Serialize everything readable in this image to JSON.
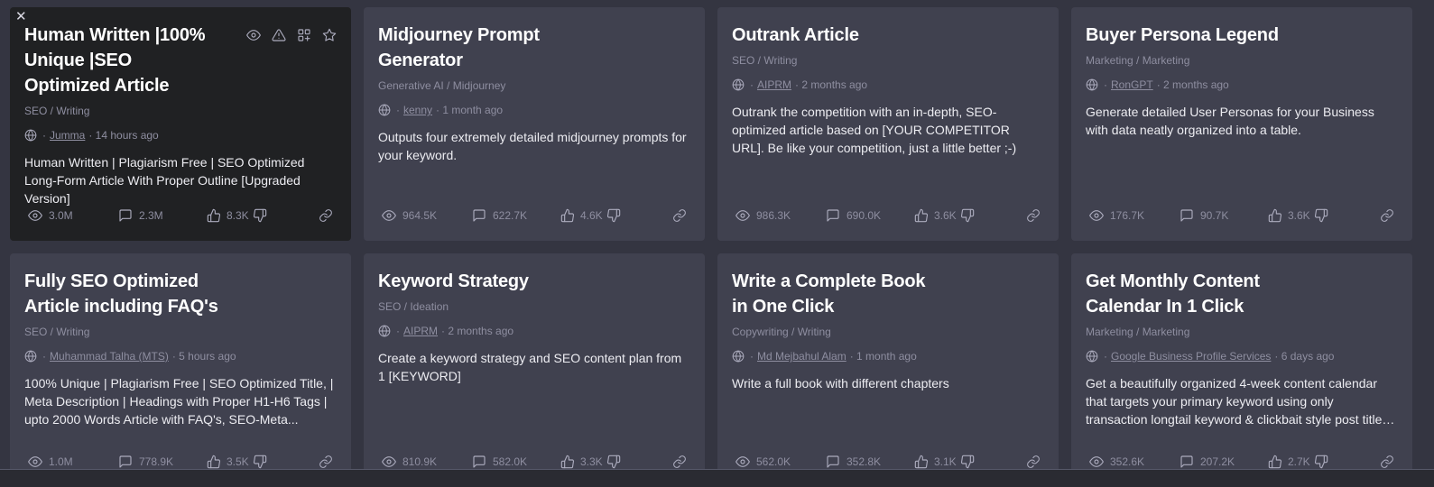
{
  "cards": [
    {
      "title": "Human Written |100% Unique |SEO Optimized Article",
      "category": "SEO / Writing",
      "author": "Jumma",
      "time": "· 14 hours ago",
      "description": "Human Written | Plagiarism Free | SEO Optimized Long-Form Article With Proper Outline [Upgraded Version]",
      "views": "3.0M",
      "comments": "2.3M",
      "likes": "8.3K",
      "active": true
    },
    {
      "title": "Midjourney Prompt Generator",
      "category": "Generative AI / Midjourney",
      "author": "kenny",
      "time": "· 1 month ago",
      "description": "Outputs four extremely detailed midjourney prompts for your keyword.",
      "views": "964.5K",
      "comments": "622.7K",
      "likes": "4.6K"
    },
    {
      "title": "Outrank Article",
      "category": "SEO / Writing",
      "author": "AIPRM",
      "time": "· 2 months ago",
      "description": "Outrank the competition with an in-depth, SEO-optimized article based on [YOUR COMPETITOR URL]. Be like your competition, just a little better ;-)",
      "views": "986.3K",
      "comments": "690.0K",
      "likes": "3.6K"
    },
    {
      "title": "Buyer Persona Legend",
      "category": "Marketing / Marketing",
      "author": "RonGPT",
      "time": "· 2 months ago",
      "description": "Generate detailed User Personas for your Business with data neatly organized into a table.",
      "views": "176.7K",
      "comments": "90.7K",
      "likes": "3.6K"
    },
    {
      "title": "Fully SEO Optimized Article including FAQ's",
      "category": "SEO / Writing",
      "author": "Muhammad Talha (MTS)",
      "time": "· 5 hours ago",
      "description": "100% Unique | Plagiarism Free | SEO Optimized Title, | Meta Description | Headings with Proper H1-H6 Tags | upto 2000 Words Article with FAQ's, SEO-Meta...",
      "views": "1.0M",
      "comments": "778.9K",
      "likes": "3.5K"
    },
    {
      "title": "Keyword Strategy",
      "category": "SEO / Ideation",
      "author": "AIPRM",
      "time": "· 2 months ago",
      "description": "Create a keyword strategy and SEO content plan from 1 [KEYWORD]",
      "views": "810.9K",
      "comments": "582.0K",
      "likes": "3.3K"
    },
    {
      "title": "Write a Complete Book in One Click",
      "category": "Copywriting / Writing",
      "author": "Md Mejbahul Alam",
      "time": "· 1 month ago",
      "description": "Write a full book with different chapters",
      "views": "562.0K",
      "comments": "352.8K",
      "likes": "3.1K"
    },
    {
      "title": "Get Monthly Content Calendar In 1 Click",
      "category": "Marketing / Marketing",
      "author": "Google Business Profile Services",
      "time": "· 6 days ago",
      "description": "Get a beautifully organized 4-week content calendar that targets your primary keyword using only transaction longtail keyword & clickbait style post titles. Try it out!",
      "views": "352.6K",
      "comments": "207.2K",
      "likes": "2.7K"
    }
  ],
  "close_glyph": "✕"
}
